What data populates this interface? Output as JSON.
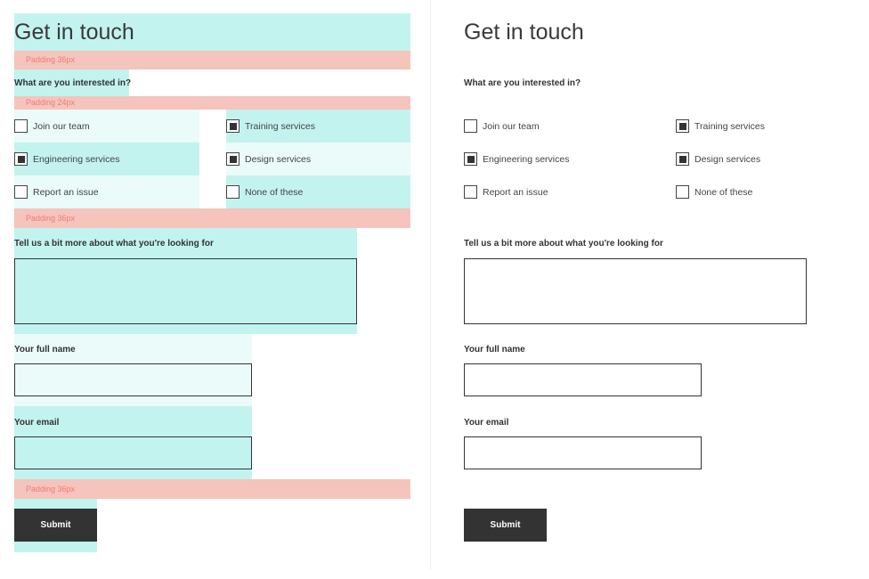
{
  "form": {
    "title": "Get in touch",
    "interest_question": "What are you interested in?",
    "options": [
      {
        "label": "Join our team",
        "checked": false
      },
      {
        "label": "Training services",
        "checked": true
      },
      {
        "label": "Engineering services",
        "checked": true
      },
      {
        "label": "Design services",
        "checked": true
      },
      {
        "label": "Report an issue",
        "checked": false
      },
      {
        "label": "None of these",
        "checked": false
      }
    ],
    "details_label": "Tell us a bit more about what you're looking for",
    "name_label": "Your full name",
    "email_label": "Your email",
    "submit_label": "Submit"
  },
  "annotations": {
    "padding_36": "Padding 36px",
    "padding_24": "Padding 24px"
  },
  "colors": {
    "highlight": "#c2f3ef",
    "highlight_light": "#eafbf9",
    "padding_band": "#f4c4bd",
    "padding_text": "#ef7d73",
    "button": "#333333"
  }
}
